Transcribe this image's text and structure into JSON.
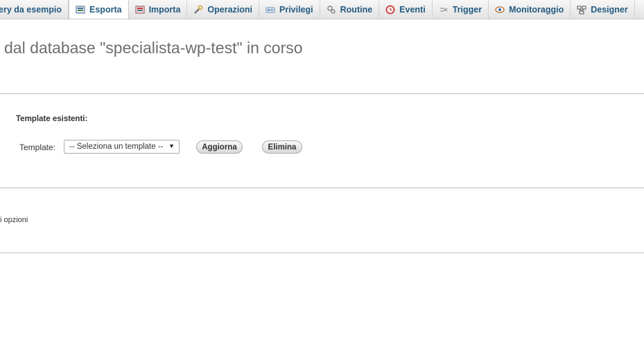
{
  "tabs": [
    {
      "label": "ery da esempio",
      "icon": "none"
    },
    {
      "label": "Esporta",
      "icon": "export-icon",
      "active": true
    },
    {
      "label": "Importa",
      "icon": "import-icon"
    },
    {
      "label": "Operazioni",
      "icon": "wrench-icon"
    },
    {
      "label": "Privilegi",
      "icon": "privileges-icon"
    },
    {
      "label": "Routine",
      "icon": "routine-icon"
    },
    {
      "label": "Eventi",
      "icon": "clock-icon"
    },
    {
      "label": "Trigger",
      "icon": "trigger-icon"
    },
    {
      "label": "Monitoraggio",
      "icon": "eye-icon"
    },
    {
      "label": "Designer",
      "icon": "designer-icon"
    }
  ],
  "main": {
    "title": " dal database \"specialista-wp-test\" in corso",
    "templates_section_label": "Template esistenti:",
    "template_label": "Template:",
    "template_select_value": "-- Seleziona un template --",
    "refresh_button": "Aggiorna",
    "delete_button": "Elimina",
    "options_text": "i opzioni"
  },
  "colors": {
    "tab_text": "#235a81",
    "title_text": "#6e6e6e",
    "divider": "#bdbdbd"
  }
}
